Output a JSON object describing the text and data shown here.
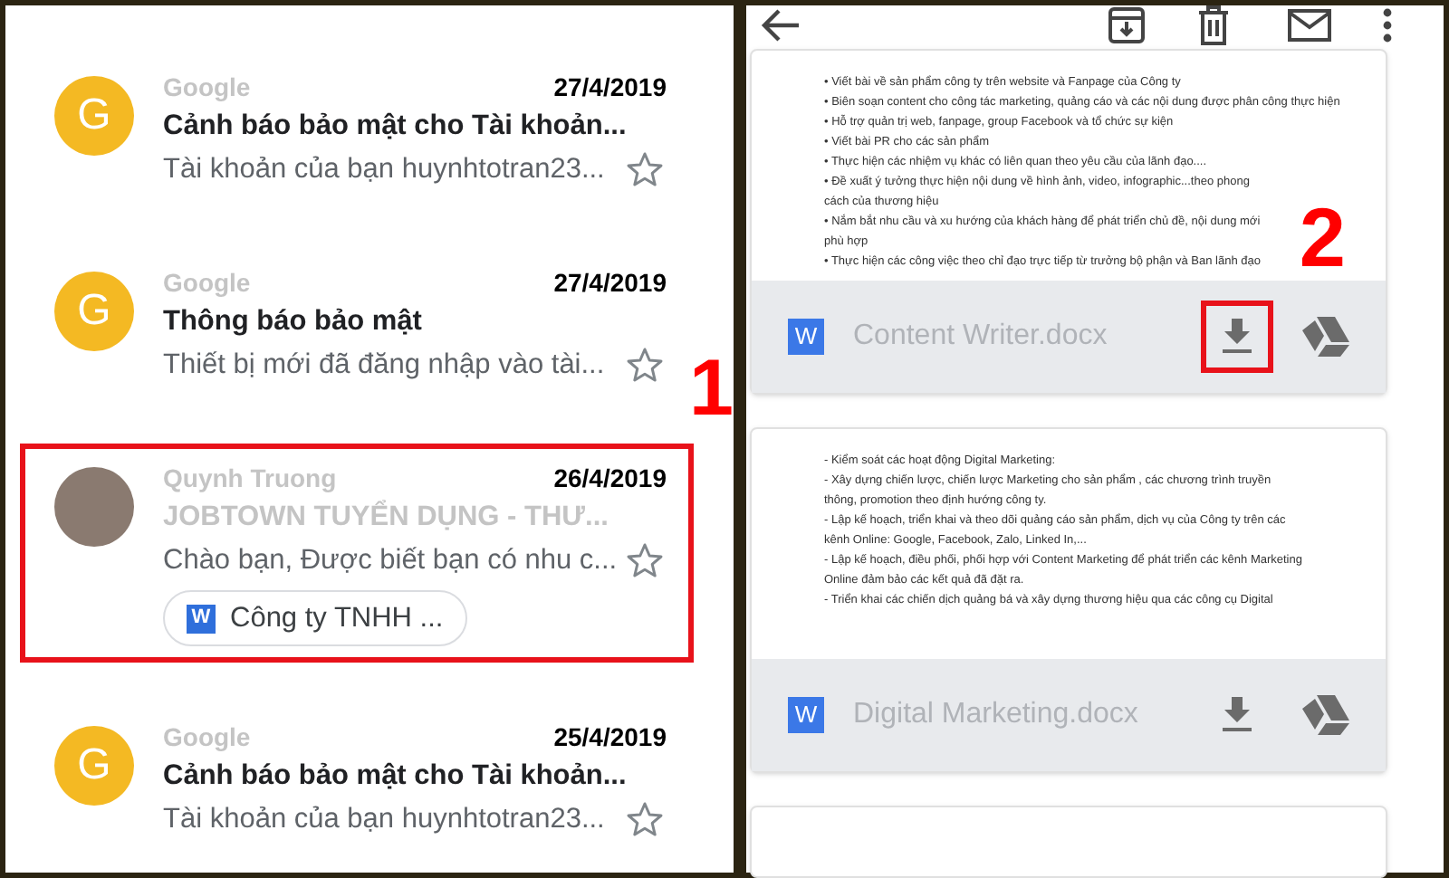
{
  "inbox": {
    "emails": [
      {
        "avatar": "G",
        "sender": "Google",
        "date": "27/4/2019",
        "subject": "Cảnh báo bảo mật cho Tài khoản...",
        "snippet": "Tài khoản của bạn huynhtotran23...",
        "starred": false,
        "highlighted": false
      },
      {
        "avatar": "G",
        "sender": "Google",
        "date": "27/4/2019",
        "subject": "Thông báo bảo mật",
        "snippet": "Thiết bị mới đã đăng nhập vào tài...",
        "starred": false,
        "highlighted": false,
        "marker": "1"
      },
      {
        "sender": "Quynh Truong",
        "date": "26/4/2019",
        "subject": "JOBTOWN TUYỂN DỤNG - THƯ...",
        "snippet": "Chào bạn, Được biết bạn có nhu c...",
        "starred": false,
        "highlighted": true,
        "attachment_icon": "W",
        "attachment": "Công ty TNHH ..."
      },
      {
        "avatar": "G",
        "sender": "Google",
        "date": "25/4/2019",
        "subject": "Cảnh báo bảo mật cho Tài khoản...",
        "snippet": "Tài khoản của bạn huynhtotran23...",
        "starred": false,
        "highlighted": false
      }
    ]
  },
  "viewer": {
    "attachments": [
      {
        "lines": [
          "• Viết bài về sản phẩm công ty trên website và Fanpage của Công ty",
          "• Biên soạn content cho công tác marketing, quảng cáo và các nội dung được phân công thực hiện",
          "• Hỗ trợ quản trị web, fanpage, group Facebook và tổ chức sự kiện",
          "• Viết bài PR cho các sản phẩm",
          "• Thực hiện các nhiệm vụ khác có liên quan theo yêu cầu của lãnh đạo....",
          "• Đề xuất ý tưởng thực hiện nội dung về hình ảnh, video, infographic...theo phong",
          "cách của thương hiệu",
          "• Nắm bắt nhu cầu và xu hướng của khách hàng để phát triển chủ đề, nội dung mới",
          "phù hợp",
          "• Thực hiện các công việc theo chỉ đạo trực tiếp từ trưởng bộ phận và Ban lãnh đạo"
        ],
        "icon": "W",
        "name": "Content Writer.docx",
        "download_highlighted": true,
        "marker": "2"
      },
      {
        "lines": [
          "- Kiểm soát các hoạt động Digital Marketing:",
          "- Xây dựng chiến lược, chiến lược Marketing cho sản phẩm , các chương trình truyền",
          "thông, promotion theo định hướng công ty.",
          "- Lập kế hoạch, triển khai và theo dõi quảng cáo sản phẩm, dịch vụ của Công ty trên các",
          "kênh Online: Google, Facebook, Zalo, Linked In,...",
          "- Lập kế hoạch, điều phối, phối hợp với Content Marketing để phát triển các kênh Marketing",
          "Online đảm bảo các kết quả đã đặt ra.",
          "- Triển khai các chiến dịch quảng bá và xây dựng thương hiệu qua các công cụ Digital"
        ],
        "icon": "W",
        "name": "Digital Marketing.docx",
        "download_highlighted": false
      }
    ]
  }
}
